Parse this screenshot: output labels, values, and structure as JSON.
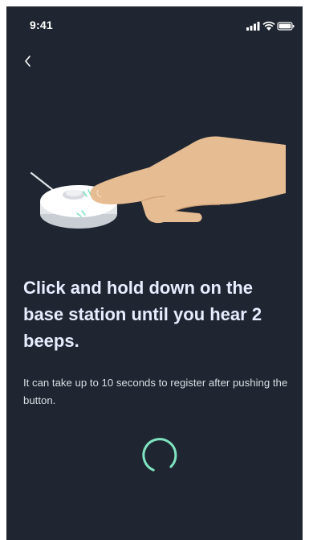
{
  "status_bar": {
    "time": "9:41"
  },
  "nav": {
    "back_icon": "chevron-left-icon"
  },
  "illustration": {
    "subject": "finger-pressing-base-station-illustration"
  },
  "content": {
    "title": "Click and hold down on the base station until you hear 2 beeps.",
    "body": "It can take up to 10 seconds to register after pushing the button."
  },
  "loading": {
    "icon": "loading-spinner-icon"
  },
  "colors": {
    "background": "#1f2631",
    "title": "#e8ecff",
    "body": "#d9dde3",
    "accent": "#7ee3c0",
    "skin": "#e6bc92"
  }
}
